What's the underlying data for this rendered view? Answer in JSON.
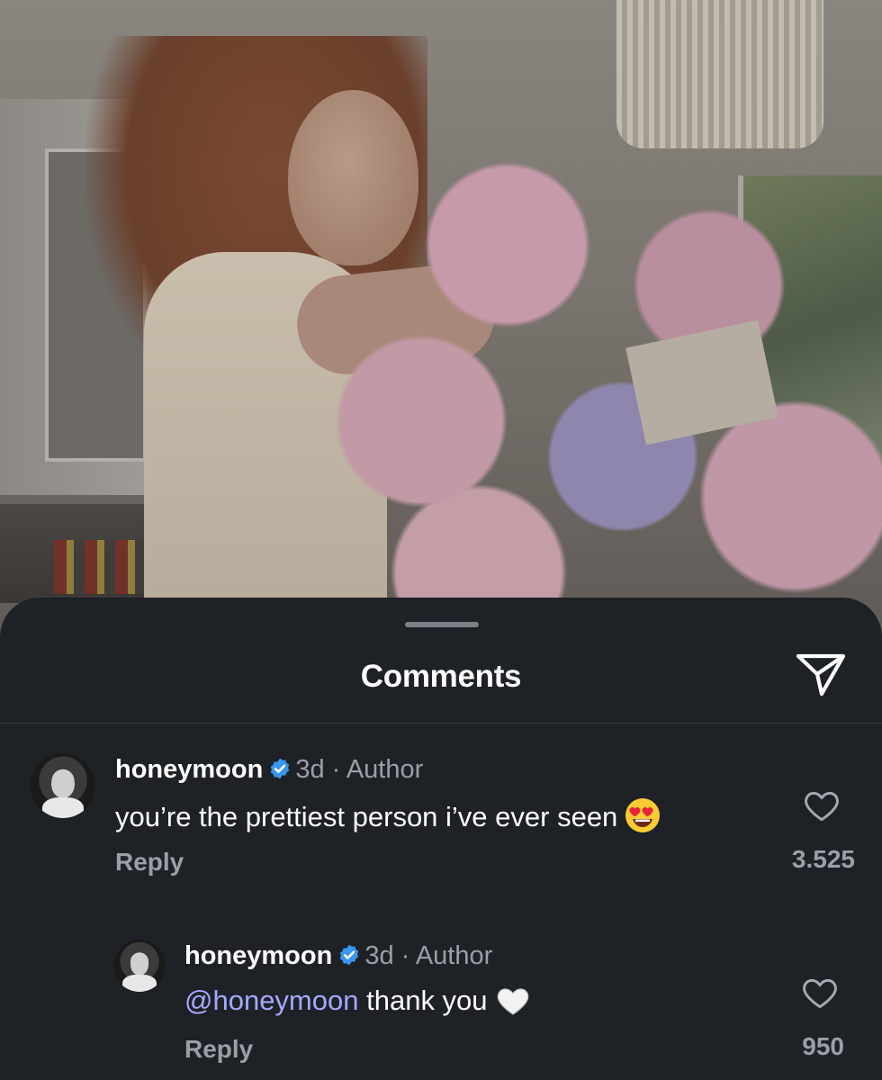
{
  "sheet": {
    "title": "Comments",
    "share_icon": "paper-plane-icon"
  },
  "comments": [
    {
      "username": "honeymoon",
      "verified": true,
      "time": "3d",
      "separator": "·",
      "tag": "Author",
      "mention": "",
      "text": "you’re the prettiest person i’ve ever seen",
      "emoji_icon": "heart-eyes-emoji",
      "reply_label": "Reply",
      "like_count": "3.525"
    },
    {
      "username": "honeymoon",
      "verified": true,
      "time": "3d",
      "separator": "·",
      "tag": "Author",
      "mention": "@honeymoon",
      "text": "thank you",
      "emoji_icon": "white-heart-emoji",
      "reply_label": "Reply",
      "like_count": "950"
    }
  ],
  "colors": {
    "sheet_bg": "#1e2126",
    "text_primary": "#ffffff",
    "text_secondary": "#9aa0a8",
    "verified_blue": "#3897f0",
    "mention": "#a6a9ff"
  }
}
